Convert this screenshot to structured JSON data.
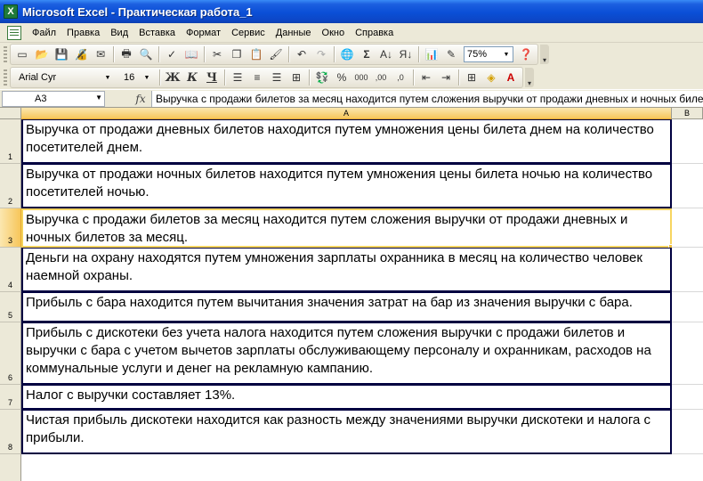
{
  "window": {
    "title": "Microsoft Excel - Практическая работа_1",
    "app_icon": "excel-icon"
  },
  "menu": {
    "items": [
      "Файл",
      "Правка",
      "Вид",
      "Вставка",
      "Формат",
      "Сервис",
      "Данные",
      "Окно",
      "Справка"
    ]
  },
  "toolbar_standard": {
    "zoom": "75%",
    "icons": [
      "new-icon",
      "open-icon",
      "save-icon",
      "permission-icon",
      "email-icon",
      "print-icon",
      "print-preview-icon",
      "spelling-icon",
      "research-icon",
      "cut-icon",
      "copy-icon",
      "paste-icon",
      "format-painter-icon",
      "undo-icon",
      "redo-icon",
      "hyperlink-icon",
      "autosum-icon",
      "sort-asc-icon",
      "sort-desc-icon",
      "chart-wizard-icon",
      "drawing-icon",
      "help-icon"
    ]
  },
  "toolbar_format": {
    "font_name": "Arial Cyr",
    "font_size": "16",
    "bold": "Ж",
    "italic": "К",
    "underline": "Ч",
    "percent": "%",
    "thousands": "000",
    "increase_decimal": ",00",
    "decrease_decimal": ",0"
  },
  "formula_bar": {
    "cell_ref": "A3",
    "fx": "fx",
    "content": "Выручка с продажи билетов за месяц находится путем сложения выручки от продажи  дневных и ночных билетов за месяц."
  },
  "grid": {
    "columns": [
      "A",
      "B"
    ],
    "rows": [
      {
        "num": "1",
        "text": "Выручка от продажи дневных билетов находится путем умножения цены билета днем на количество посетителей днем."
      },
      {
        "num": "2",
        "text": "Выручка от продажи ночных билетов находится путем умножения цены билета ночью на количество посетителей ночью."
      },
      {
        "num": "3",
        "text": "Выручка с продажи билетов за месяц находится путем сложения выручки от продажи  дневных и ночных билетов за месяц."
      },
      {
        "num": "4",
        "text": "Деньги на охрану находятся путем умножения зарплаты охранника в месяц на количество человек наемной охраны."
      },
      {
        "num": "5",
        "text": "Прибыль с бара  находится путем вычитания значения затрат на бар из значения выручки с  бара."
      },
      {
        "num": "6",
        "text": "Прибыль с дискотеки без учета налога находится путем сложения выручки с продажи билетов и выручки с бара с учетом вычетов зарплаты обслуживающему персоналу и охранникам, расходов на коммунальные услуги и денег на рекламную кампанию."
      },
      {
        "num": "7",
        "text": "Налог с выручки составляет 13%."
      },
      {
        "num": "8",
        "text": "Чистая прибыль дискотеки находится как разность между значениями выручки дискотеки и налога с прибыли."
      }
    ]
  }
}
